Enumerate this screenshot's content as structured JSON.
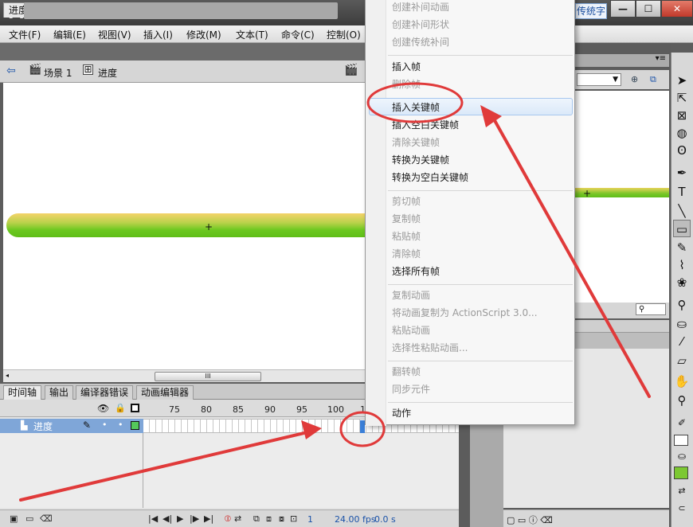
{
  "app": {
    "logo": "Fl",
    "workspace_label": "传统字型"
  },
  "window_controls": {
    "minimize": "—",
    "maximize": "☐",
    "close": "✕"
  },
  "menubar": [
    "文件(F)",
    "编辑(E)",
    "视图(V)",
    "插入(I)",
    "修改(M)",
    "文本(T)",
    "命令(C)",
    "控制(O)"
  ],
  "document": {
    "tab_title": "进度条动画.fla",
    "tab_close": "×"
  },
  "editbar": {
    "scene_label": "场景 1",
    "symbol_label": "进度"
  },
  "panel_tabs": [
    "时间轴",
    "输出",
    "编译器错误",
    "动画编辑器"
  ],
  "timeline": {
    "frame_numbers": [
      "75",
      "80",
      "85",
      "90",
      "95",
      "100",
      "1"
    ],
    "layer_name": "进度",
    "frame_number": "1",
    "fps": "24.00 fps",
    "time": "0.0 s"
  },
  "context_menu": {
    "groups": [
      [
        {
          "label": "创建补间动画",
          "enabled": false
        },
        {
          "label": "创建补间形状",
          "enabled": false
        },
        {
          "label": "创建传统补间",
          "enabled": false
        }
      ],
      [
        {
          "label": "插入帧",
          "enabled": true
        },
        {
          "label": "删除帧",
          "enabled": false
        },
        {
          "label": "插入关键帧",
          "enabled": true
        },
        {
          "label": "插入空白关键帧",
          "enabled": true
        },
        {
          "label": "清除关键帧",
          "enabled": false
        },
        {
          "label": "转换为关键帧",
          "enabled": true
        },
        {
          "label": "转换为空白关键帧",
          "enabled": true
        }
      ],
      [
        {
          "label": "剪切帧",
          "enabled": false
        },
        {
          "label": "复制帧",
          "enabled": false
        },
        {
          "label": "粘贴帧",
          "enabled": false
        },
        {
          "label": "清除帧",
          "enabled": false
        },
        {
          "label": "选择所有帧",
          "enabled": true
        }
      ],
      [
        {
          "label": "复制动画",
          "enabled": false
        },
        {
          "label": "将动画复制为 ActionScript 3.0...",
          "enabled": false
        },
        {
          "label": "粘贴动画",
          "enabled": false
        },
        {
          "label": "选择性粘贴动画...",
          "enabled": false
        }
      ],
      [
        {
          "label": "翻转帧",
          "enabled": false
        },
        {
          "label": "同步元件",
          "enabled": false
        }
      ],
      [
        {
          "label": "动作",
          "enabled": true
        }
      ]
    ],
    "highlighted": "插入关键帧"
  },
  "colors": {
    "annotation_red": "#e03a3a",
    "highlight_blue": "#3a7fd8",
    "progress_green": "#6cc820",
    "progress_yellow": "#f5d36a"
  },
  "icons": [
    "back-arrow-icon",
    "scene-icon",
    "symbol-icon",
    "edit-scene-icon",
    "eye-icon",
    "lock-icon",
    "outline-icon",
    "pencil-icon",
    "selection-tool-icon",
    "subselection-tool-icon",
    "free-transform-icon",
    "3d-rotation-icon",
    "lasso-icon",
    "pen-icon",
    "text-tool-icon",
    "line-tool-icon",
    "rectangle-tool-icon",
    "pencil-tool-icon",
    "brush-tool-icon",
    "deco-tool-icon",
    "bone-tool-icon",
    "paint-bucket-icon",
    "eyedropper-icon",
    "eraser-icon",
    "hand-tool-icon",
    "zoom-tool-icon"
  ]
}
